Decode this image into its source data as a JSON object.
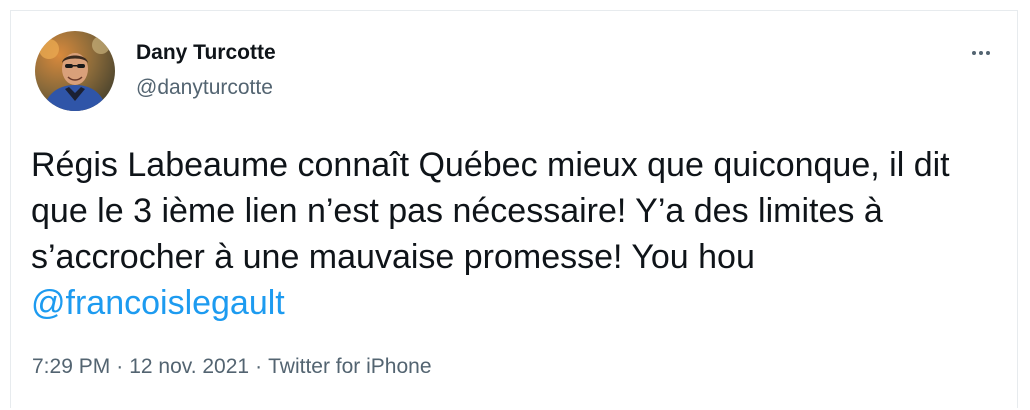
{
  "author": {
    "display_name": "Dany Turcotte",
    "handle": "@danyturcotte"
  },
  "tweet": {
    "text": "Régis Labeaume connaît Québec mieux que quiconque, il dit que le 3 ième lien n’est pas nécessaire! Y’a des limites à s’accrocher à une mauvaise promesse! You hou ",
    "mention": "@francoislegault"
  },
  "meta": {
    "time": "7:29 PM",
    "date": "12 nov. 2021",
    "source": "Twitter for iPhone",
    "separator": "·"
  },
  "icons": {
    "more": "more-horizontal-icon"
  },
  "colors": {
    "mention": "#1d9bf0",
    "secondary_text": "#536471",
    "primary_text": "#0f1419"
  }
}
